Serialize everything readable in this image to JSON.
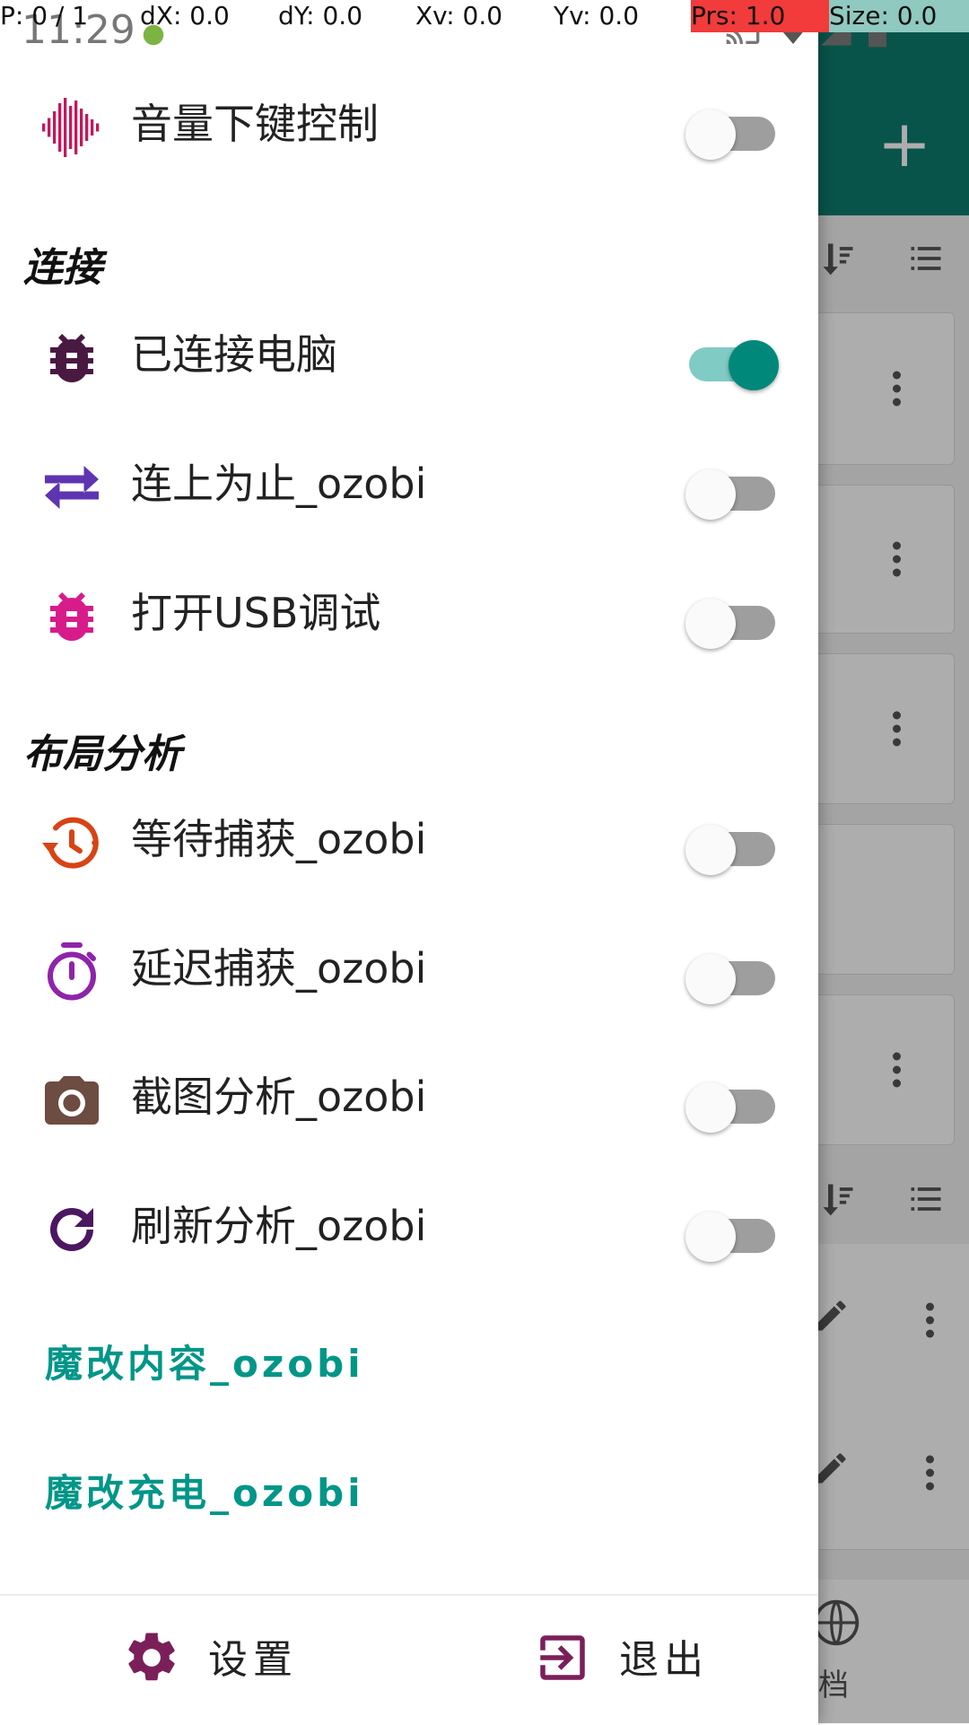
{
  "status_bar": {
    "time": "11:29"
  },
  "pointer_overlay": {
    "p": "P: 0 / 1",
    "dx": "dX: 0.0",
    "dy": "dY: 0.0",
    "xv": "Xv: 0.0",
    "yv": "Yv: 0.0",
    "prs": "Prs: 1.0",
    "size": "Size: 0.0"
  },
  "background_app": {
    "add_button": "+",
    "bottom_label": "档"
  },
  "drawer": {
    "top_item": {
      "label": "音量下键控制",
      "icon": "waveform-icon",
      "icon_color": "#c2185b",
      "on": false
    },
    "sections": [
      {
        "header": "连接",
        "items": [
          {
            "label": "已连接电脑",
            "icon": "bug-icon",
            "icon_color": "#4a1942",
            "on": true
          },
          {
            "label": "连上为止_ozobi",
            "icon": "swap-arrows-icon",
            "icon_color": "#5e35b1",
            "on": false
          },
          {
            "label": "打开USB调试",
            "icon": "bug-icon",
            "icon_color": "#d81b8a",
            "on": false
          }
        ]
      },
      {
        "header": "布局分析",
        "items": [
          {
            "label": "等待捕获_ozobi",
            "icon": "timer-clock-icon",
            "icon_color": "#d84315",
            "on": false
          },
          {
            "label": "延迟捕获_ozobi",
            "icon": "stopwatch-icon",
            "icon_color": "#8e24aa",
            "on": false
          },
          {
            "label": "截图分析_ozobi",
            "icon": "camera-icon",
            "icon_color": "#6d4c41",
            "on": false
          },
          {
            "label": "刷新分析_ozobi",
            "icon": "refresh-icon",
            "icon_color": "#4a1760",
            "on": false
          }
        ]
      }
    ],
    "links": [
      {
        "label": "魔改内容_ozobi"
      },
      {
        "label": "魔改充电_ozobi"
      }
    ],
    "footer": {
      "settings_label": "设置",
      "exit_label": "退出",
      "icon_color": "#7b1f5a"
    }
  },
  "colors": {
    "accent": "#009688",
    "switch_on_thumb": "#00897b",
    "switch_on_track": "#80cbc4",
    "app_bar": "#0e7c6e"
  }
}
